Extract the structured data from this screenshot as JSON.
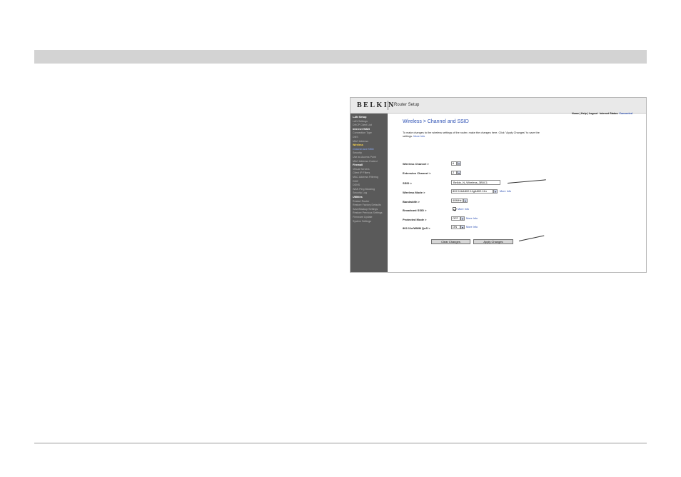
{
  "router": {
    "brand": "BELKIN",
    "app_title": "Router Setup",
    "top_links": {
      "home": "Home",
      "help": "Help",
      "logout": "Logout",
      "internet_status_label": "Internet Status:",
      "internet_status_value": "Connected"
    },
    "sidebar": [
      {
        "label": "LAN Setup",
        "type": "header"
      },
      {
        "label": "LAN Settings",
        "type": "item"
      },
      {
        "label": "DHCP Client List",
        "type": "item"
      },
      {
        "label": "Internet WAN",
        "type": "header"
      },
      {
        "label": "Connection Type",
        "type": "item"
      },
      {
        "label": "DNS",
        "type": "item"
      },
      {
        "label": "MAC Address",
        "type": "item"
      },
      {
        "label": "Wireless",
        "type": "active"
      },
      {
        "label": "Channel and SSID",
        "type": "sub"
      },
      {
        "label": "Security",
        "type": "item"
      },
      {
        "label": "Use as Access Point",
        "type": "item"
      },
      {
        "label": "MAC Address Control",
        "type": "item"
      },
      {
        "label": "Firewall",
        "type": "header"
      },
      {
        "label": "Virtual Servers",
        "type": "item"
      },
      {
        "label": "Client IP Filters",
        "type": "item"
      },
      {
        "label": "MAC Address Filtering",
        "type": "item"
      },
      {
        "label": "DMZ",
        "type": "item"
      },
      {
        "label": "DDNS",
        "type": "item"
      },
      {
        "label": "WAN Ping Blocking",
        "type": "item"
      },
      {
        "label": "Security Log",
        "type": "item"
      },
      {
        "label": "Utilities",
        "type": "header"
      },
      {
        "label": "Restart Router",
        "type": "item"
      },
      {
        "label": "Restore Factory Defaults",
        "type": "item"
      },
      {
        "label": "Save/Backup Settings",
        "type": "item"
      },
      {
        "label": "Restore Previous Settings",
        "type": "item"
      },
      {
        "label": "Firmware Update",
        "type": "item"
      },
      {
        "label": "System Settings",
        "type": "item"
      }
    ],
    "page_title": "Wireless > Channel and SSID",
    "intro_text": "To make changes to the wireless settings of the router, make the changes here. Click \"Apply Changes\" to save the settings.",
    "more_info": "More Info",
    "fields": {
      "wireless_channel": {
        "label": "Wireless Channel >",
        "value": "6"
      },
      "extension_channel": {
        "label": "Extension Channel >",
        "value": "2"
      },
      "ssid": {
        "label": "SSID >",
        "value": "Belkin_N_Wireless_3B5C1"
      },
      "wireless_mode": {
        "label": "Wireless Mode >",
        "value": "802.11b&802.11g&802.11n"
      },
      "bandwidth": {
        "label": "Bandwidth >",
        "value": "40MHz"
      },
      "broadcast_ssid": {
        "label": "Broadcast SSID >",
        "checked": true
      },
      "protected_mode": {
        "label": "Protected Mode >",
        "value": "OFF"
      },
      "qos": {
        "label": "802.11e/WMM QoS >",
        "value": "ON"
      }
    },
    "buttons": {
      "clear": "Clear Changes",
      "apply": "Apply Changes"
    }
  }
}
